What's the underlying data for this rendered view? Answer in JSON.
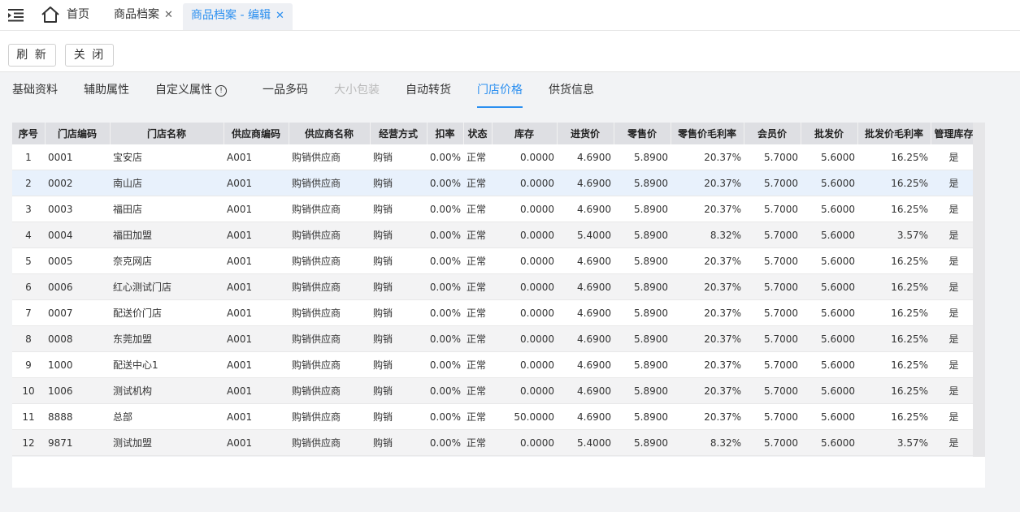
{
  "tabs": {
    "home": "首页",
    "tab1": "商品档案",
    "tab2": "商品档案 - 编辑",
    "close_glyph": "✕"
  },
  "toolbar": {
    "refresh": "刷 新",
    "close": "关 闭"
  },
  "subnav": {
    "items": [
      "基础资料",
      "辅助属性",
      "自定义属性",
      "一品多码",
      "大小包装",
      "自动转货",
      "门店价格",
      "供货信息"
    ],
    "info_glyph": "!",
    "active": "门店价格",
    "disabled": "大小包装"
  },
  "table": {
    "headers": [
      "序号",
      "门店编码",
      "门店名称",
      "供应商编码",
      "供应商名称",
      "经营方式",
      "扣率",
      "状态",
      "库存",
      "进货价",
      "零售价",
      "零售价毛利率",
      "会员价",
      "批发价",
      "批发价毛利率",
      "管理库存"
    ],
    "rows": [
      [
        "1",
        "0001",
        "宝安店",
        "A001",
        "购销供应商",
        "购销",
        "0.00%",
        "正常",
        "0.0000",
        "4.6900",
        "5.8900",
        "20.37%",
        "5.7000",
        "5.6000",
        "16.25%",
        "是"
      ],
      [
        "2",
        "0002",
        "南山店",
        "A001",
        "购销供应商",
        "购销",
        "0.00%",
        "正常",
        "0.0000",
        "4.6900",
        "5.8900",
        "20.37%",
        "5.7000",
        "5.6000",
        "16.25%",
        "是"
      ],
      [
        "3",
        "0003",
        "福田店",
        "A001",
        "购销供应商",
        "购销",
        "0.00%",
        "正常",
        "0.0000",
        "4.6900",
        "5.8900",
        "20.37%",
        "5.7000",
        "5.6000",
        "16.25%",
        "是"
      ],
      [
        "4",
        "0004",
        "福田加盟",
        "A001",
        "购销供应商",
        "购销",
        "0.00%",
        "正常",
        "0.0000",
        "5.4000",
        "5.8900",
        "8.32%",
        "5.7000",
        "5.6000",
        "3.57%",
        "是"
      ],
      [
        "5",
        "0005",
        "奈克网店",
        "A001",
        "购销供应商",
        "购销",
        "0.00%",
        "正常",
        "0.0000",
        "4.6900",
        "5.8900",
        "20.37%",
        "5.7000",
        "5.6000",
        "16.25%",
        "是"
      ],
      [
        "6",
        "0006",
        "红心测试门店",
        "A001",
        "购销供应商",
        "购销",
        "0.00%",
        "正常",
        "0.0000",
        "4.6900",
        "5.8900",
        "20.37%",
        "5.7000",
        "5.6000",
        "16.25%",
        "是"
      ],
      [
        "7",
        "0007",
        "配送价门店",
        "A001",
        "购销供应商",
        "购销",
        "0.00%",
        "正常",
        "0.0000",
        "4.6900",
        "5.8900",
        "20.37%",
        "5.7000",
        "5.6000",
        "16.25%",
        "是"
      ],
      [
        "8",
        "0008",
        "东莞加盟",
        "A001",
        "购销供应商",
        "购销",
        "0.00%",
        "正常",
        "0.0000",
        "4.6900",
        "5.8900",
        "20.37%",
        "5.7000",
        "5.6000",
        "16.25%",
        "是"
      ],
      [
        "9",
        "1000",
        "配送中心1",
        "A001",
        "购销供应商",
        "购销",
        "0.00%",
        "正常",
        "0.0000",
        "4.6900",
        "5.8900",
        "20.37%",
        "5.7000",
        "5.6000",
        "16.25%",
        "是"
      ],
      [
        "10",
        "1006",
        "测试机构",
        "A001",
        "购销供应商",
        "购销",
        "0.00%",
        "正常",
        "0.0000",
        "4.6900",
        "5.8900",
        "20.37%",
        "5.7000",
        "5.6000",
        "16.25%",
        "是"
      ],
      [
        "11",
        "8888",
        "总部",
        "A001",
        "购销供应商",
        "购销",
        "0.00%",
        "正常",
        "50.0000",
        "4.6900",
        "5.8900",
        "20.37%",
        "5.7000",
        "5.6000",
        "16.25%",
        "是"
      ],
      [
        "12",
        "9871",
        "测试加盟",
        "A001",
        "购销供应商",
        "购销",
        "0.00%",
        "正常",
        "0.0000",
        "5.4000",
        "5.8900",
        "8.32%",
        "5.7000",
        "5.6000",
        "3.57%",
        "是"
      ]
    ],
    "highlighted_row": 2
  },
  "colors": {
    "accent": "#2b8ff0",
    "header_bg": "#dedfe3",
    "highlight_row": "#e8f1fc"
  }
}
